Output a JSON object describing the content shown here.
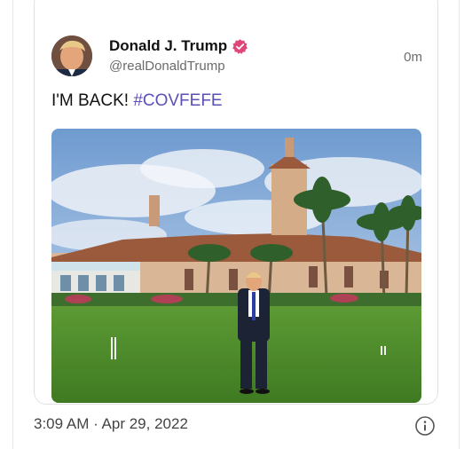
{
  "tweet": {
    "display_name": "Donald J. Trump",
    "handle": "@realDonaldTrump",
    "time_ago": "0m",
    "text_main": "I'M BACK! ",
    "hashtag": "#COVFEFE",
    "timestamp": "3:09 AM · Apr 29, 2022"
  },
  "icons": {
    "verified": "verified-badge-icon",
    "info": "info-icon"
  },
  "colors": {
    "verified_badge": "#e0457b",
    "hashtag": "#5b4fb8",
    "lawn": "#4f8a2c",
    "sky": "#7fa8d6"
  }
}
